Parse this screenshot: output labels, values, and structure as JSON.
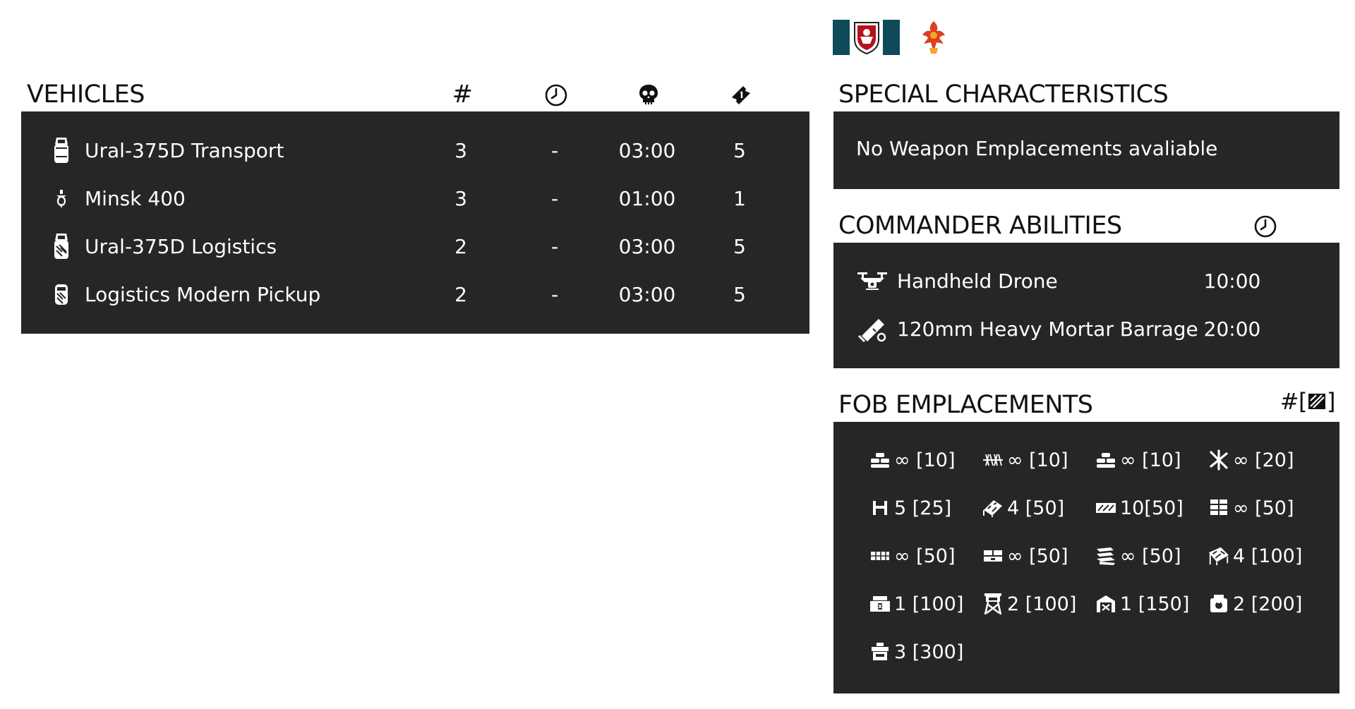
{
  "vehicles": {
    "title": "VEHICLES",
    "col_count": "#",
    "col_delay_icon": "clock-icon",
    "col_respawn_icon": "skull-icon",
    "col_tickets_icon": "ticket-icon",
    "rows": [
      {
        "icon": "truck-icon",
        "name": "Ural-375D Transport",
        "count": "3",
        "delay": "-",
        "respawn": "03:00",
        "tickets": "5"
      },
      {
        "icon": "motorbike-icon",
        "name": "Minsk 400",
        "count": "3",
        "delay": "-",
        "respawn": "01:00",
        "tickets": "1"
      },
      {
        "icon": "logistics-truck-icon",
        "name": "Ural-375D Logistics",
        "count": "2",
        "delay": "-",
        "respawn": "03:00",
        "tickets": "5"
      },
      {
        "icon": "pickup-icon",
        "name": "Logistics Modern Pickup",
        "count": "2",
        "delay": "-",
        "respawn": "03:00",
        "tickets": "5"
      }
    ]
  },
  "special": {
    "title": "SPECIAL CHARACTERISTICS",
    "text": "No Weapon Emplacements avaliable"
  },
  "commander": {
    "title": "COMMANDER ABILITIES",
    "col_icon": "clock-icon",
    "rows": [
      {
        "icon": "drone-icon",
        "name": "Handheld Drone",
        "time": "10:00"
      },
      {
        "icon": "mortar-icon",
        "name": "120mm Heavy Mortar Barrage",
        "time": "20:00"
      }
    ]
  },
  "fob": {
    "title": "FOB EMPLACEMENTS",
    "col_label": "#[",
    "col_label_end": "]",
    "col_icon": "construction-icon",
    "items": [
      {
        "icon": "sandbag-icon",
        "text": "∞ [10]"
      },
      {
        "icon": "razorwire-icon",
        "text": "∞ [10]"
      },
      {
        "icon": "sandbag-icon",
        "text": "∞ [10]"
      },
      {
        "icon": "tank-trap-icon",
        "text": "∞ [20]"
      },
      {
        "icon": "barrier-icon",
        "text": "5 [25]"
      },
      {
        "icon": "camo-net-icon",
        "text": "4 [50]"
      },
      {
        "icon": "camo-wall-icon",
        "text": "10[50]"
      },
      {
        "icon": "sandbag-wall-icon",
        "text": "∞ [50]"
      },
      {
        "icon": "low-wall-icon",
        "text": "∞ [50]"
      },
      {
        "icon": "bunker-wall-icon",
        "text": "∞ [50]"
      },
      {
        "icon": "stack-wall-icon",
        "text": "∞ [50]"
      },
      {
        "icon": "camo-large-icon",
        "text": "4 [100]"
      },
      {
        "icon": "ammo-crate-icon",
        "text": "1 [100]"
      },
      {
        "icon": "watchtower-icon",
        "text": "2 [100]"
      },
      {
        "icon": "repair-station-icon",
        "text": "1 [150]"
      },
      {
        "icon": "hab-icon",
        "text": "2 [200]"
      },
      {
        "icon": "bunker-icon",
        "text": "3 [300]"
      }
    ]
  },
  "header": {
    "flag_icon": "faction-flag-icon",
    "emblem_icon": "faction-emblem-icon"
  }
}
